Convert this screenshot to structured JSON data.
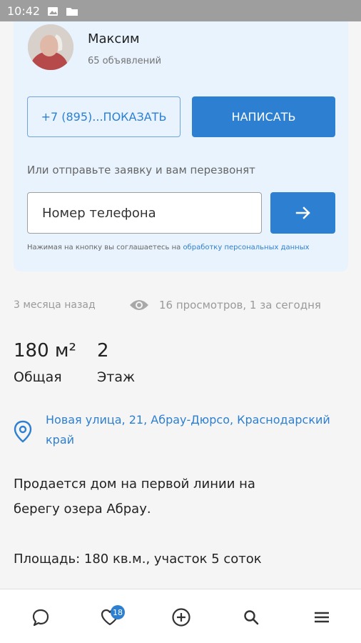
{
  "status_bar": {
    "time": "10:42"
  },
  "seller": {
    "name": "Максим",
    "ads_count": "65 объявлений"
  },
  "contact": {
    "phone_button": "+7 (895)...ПОКАЗАТЬ",
    "write_button": "НАПИСАТЬ",
    "callback_prompt": "Или отправьте заявку и вам перезвонят",
    "phone_placeholder": "Номер телефона",
    "agreement_text": "Нажимая на кнопку вы соглашаетесь на",
    "agreement_link": "обработку персональных данных"
  },
  "meta": {
    "posted": "3 месяца назад",
    "views": "16 просмотров, 1 за сегодня"
  },
  "stats": [
    {
      "value": "180 м²",
      "label": "Общая"
    },
    {
      "value": "2",
      "label": "Этаж"
    }
  ],
  "address": "Новая улица, 21, Абрау-Дюрсо, Краснодарский край",
  "description": {
    "line1": "Продается дом на первой линии на",
    "line2": "берегу озера Абрау.",
    "line3": "Площадь: 180 кв.м., участок 5 соток"
  },
  "bottom_nav": {
    "favorites_badge": "18",
    "icons": [
      "chat-icon",
      "heart-icon",
      "add-icon",
      "search-icon",
      "menu-icon"
    ]
  },
  "colors": {
    "accent": "#2d7fd2",
    "card_bg": "#e8f3fd",
    "status_bar": "#9e9e9e"
  }
}
